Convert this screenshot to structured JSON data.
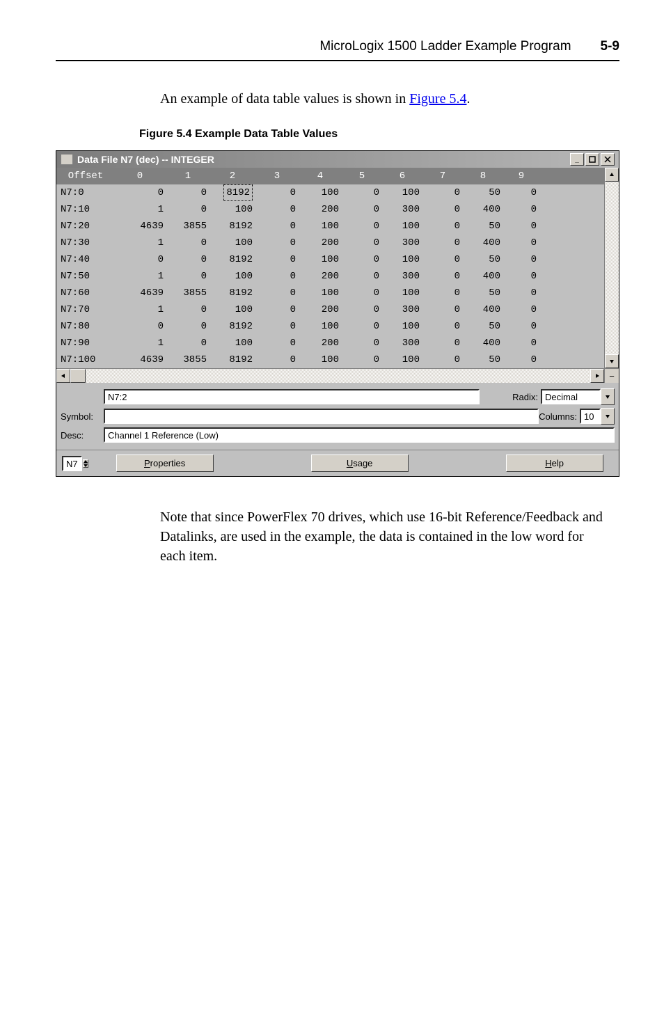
{
  "header": {
    "title": "MicroLogix 1500 Ladder Example Program",
    "pageno": "5-9"
  },
  "intro_pre": "An example of data table values is shown in ",
  "intro_link": "Figure 5.4",
  "intro_post": ".",
  "figure_caption": "Figure 5.4   Example Data Table Values",
  "window": {
    "title": "Data File N7 (dec)  --  INTEGER",
    "columns": [
      "Offset",
      "0",
      "1",
      "2",
      "3",
      "4",
      "5",
      "6",
      "7",
      "8",
      "9"
    ],
    "rows": [
      [
        "N7:0",
        "0",
        "0",
        "8192",
        "0",
        "100",
        "0",
        "100",
        "0",
        "50",
        "0"
      ],
      [
        "N7:10",
        "1",
        "0",
        "100",
        "0",
        "200",
        "0",
        "300",
        "0",
        "400",
        "0"
      ],
      [
        "N7:20",
        "4639",
        "3855",
        "8192",
        "0",
        "100",
        "0",
        "100",
        "0",
        "50",
        "0"
      ],
      [
        "N7:30",
        "1",
        "0",
        "100",
        "0",
        "200",
        "0",
        "300",
        "0",
        "400",
        "0"
      ],
      [
        "N7:40",
        "0",
        "0",
        "8192",
        "0",
        "100",
        "0",
        "100",
        "0",
        "50",
        "0"
      ],
      [
        "N7:50",
        "1",
        "0",
        "100",
        "0",
        "200",
        "0",
        "300",
        "0",
        "400",
        "0"
      ],
      [
        "N7:60",
        "4639",
        "3855",
        "8192",
        "0",
        "100",
        "0",
        "100",
        "0",
        "50",
        "0"
      ],
      [
        "N7:70",
        "1",
        "0",
        "100",
        "0",
        "200",
        "0",
        "300",
        "0",
        "400",
        "0"
      ],
      [
        "N7:80",
        "0",
        "0",
        "8192",
        "0",
        "100",
        "0",
        "100",
        "0",
        "50",
        "0"
      ],
      [
        "N7:90",
        "1",
        "0",
        "100",
        "0",
        "200",
        "0",
        "300",
        "0",
        "400",
        "0"
      ],
      [
        "N7:100",
        "4639",
        "3855",
        "8192",
        "0",
        "100",
        "0",
        "100",
        "0",
        "50",
        "0"
      ]
    ],
    "selected_cell": {
      "row": 0,
      "col": 3
    },
    "addr_label": " ",
    "addr_value": "N7:2",
    "radix_label": "Radix:",
    "radix_value": "Decimal",
    "symbol_label": "Symbol:",
    "symbol_value": "",
    "columns_label": "Columns:",
    "columns_value": "10",
    "desc_label": "Desc:",
    "desc_value": "Channel 1 Reference (Low)",
    "file_value": "N7",
    "properties_btn": "Properties",
    "usage_btn": "Usage",
    "help_btn": "Help"
  },
  "note": "Note that since PowerFlex 70 drives, which use 16-bit Reference/Feedback and Datalinks, are used in the example, the data is contained in the low word for each item."
}
